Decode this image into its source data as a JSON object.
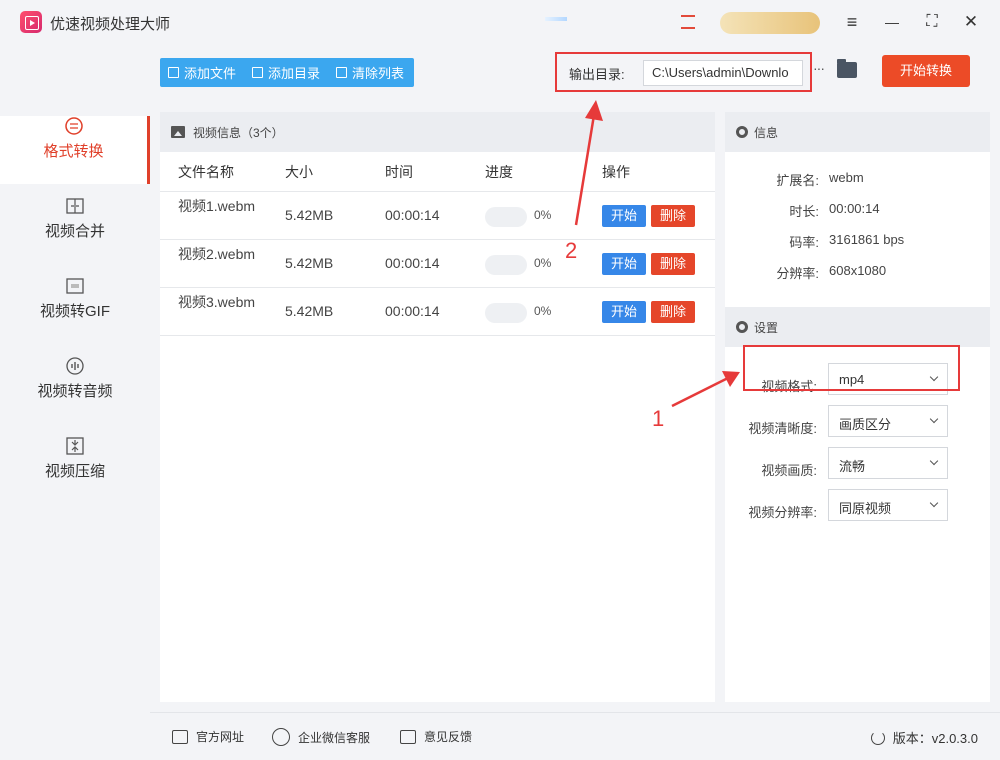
{
  "app": {
    "title": "优速视频处理大师"
  },
  "window_controls": {
    "menu": "≡",
    "minimize": "—",
    "maximize": "⛶",
    "close": "✕"
  },
  "sidebar": {
    "items": [
      {
        "label": "格式转换",
        "icon": "format-convert-icon",
        "active": true
      },
      {
        "label": "视频合并",
        "icon": "merge-icon",
        "active": false
      },
      {
        "label": "视频转GIF",
        "icon": "gif-icon",
        "active": false
      },
      {
        "label": "视频转音频",
        "icon": "audio-icon",
        "active": false
      },
      {
        "label": "视频压缩",
        "icon": "compress-icon",
        "active": false
      }
    ]
  },
  "toolbar": {
    "add_file": "添加文件",
    "add_folder": "添加目录",
    "clear_list": "清除列表",
    "output_label": "输出目录:",
    "output_path": "C:\\Users\\admin\\Downlo",
    "more": "···",
    "start_convert": "开始转换"
  },
  "file_list": {
    "header": "视频信息（3个）",
    "columns": {
      "name": "文件名称",
      "size": "大小",
      "time": "时间",
      "progress": "进度",
      "ops": "操作"
    },
    "rows": [
      {
        "name": "视频1.webm",
        "size": "5.42MB",
        "time": "00:00:14",
        "progress": 0,
        "progress_text": "0%",
        "start": "开始",
        "delete": "删除"
      },
      {
        "name": "视频2.webm",
        "size": "5.42MB",
        "time": "00:00:14",
        "progress": 0,
        "progress_text": "0%",
        "start": "开始",
        "delete": "删除"
      },
      {
        "name": "视频3.webm",
        "size": "5.42MB",
        "time": "00:00:14",
        "progress": 0,
        "progress_text": "0%",
        "start": "开始",
        "delete": "删除"
      }
    ]
  },
  "info": {
    "header": "信息",
    "rows": [
      {
        "key": "扩展名:",
        "value": "webm"
      },
      {
        "key": "时长:",
        "value": "00:00:14"
      },
      {
        "key": "码率:",
        "value": "3161861 bps"
      },
      {
        "key": "分辨率:",
        "value": "608x1080"
      }
    ]
  },
  "settings": {
    "header": "设置",
    "rows": [
      {
        "key": "视频格式:",
        "value": "mp4"
      },
      {
        "key": "视频清晰度:",
        "value": "画质区分"
      },
      {
        "key": "视频画质:",
        "value": "流畅"
      },
      {
        "key": "视频分辨率:",
        "value": "同原视频"
      }
    ]
  },
  "annotations": {
    "one": "1",
    "two": "2",
    "color": "#e63a3a"
  },
  "footer": {
    "website": "官方网址",
    "wechat": "企业微信客服",
    "feedback": "意见反馈",
    "version": "版本：v2.0.3.0"
  }
}
